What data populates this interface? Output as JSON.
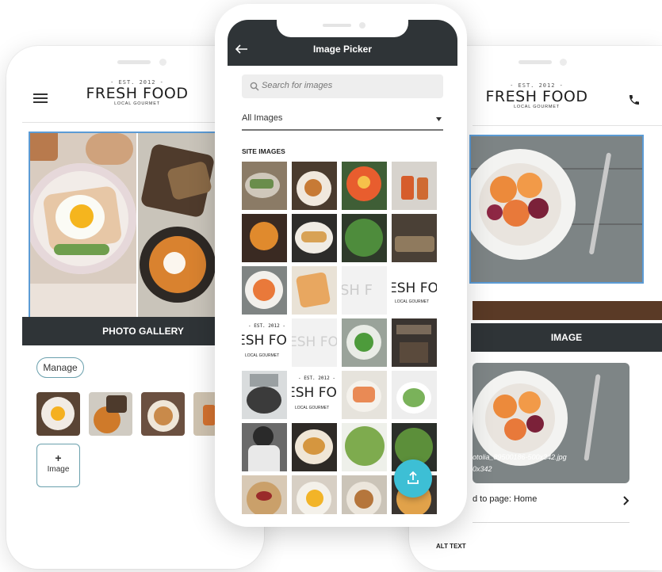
{
  "left_phone": {
    "brand": {
      "est": "- EST. 2012 -",
      "name": "FRESH FOOD",
      "sub": "LOCAL GOURMET"
    },
    "section_title": "PHOTO GALLERY",
    "manage_label": "Manage",
    "add_image_plus": "+",
    "add_image_label": "Image",
    "icons": {
      "menu": "hamburger-menu-icon"
    }
  },
  "center_phone": {
    "header": {
      "title": "Image Picker",
      "back_icon": "back-arrow-icon"
    },
    "search": {
      "placeholder": "Search for images",
      "icon": "search-icon"
    },
    "filter": {
      "selected": "All Images",
      "icon": "caret-down-icon"
    },
    "section_label": "SITE IMAGES",
    "tile_text": {
      "est": "- EST. 2012 -",
      "name_partial_a": "ESH FO",
      "name_partial_b": "ESH FO",
      "sub": "LOCAL GOURMET"
    },
    "fab_icon": "upload-icon"
  },
  "right_phone": {
    "brand": {
      "est": "- EST. 2012 -",
      "name": "FRESH FOOD",
      "sub": "LOCAL GOURMET"
    },
    "section_title": "IMAGE",
    "filename": "otolia_89500186-500x342.jpg",
    "dims": "0x342",
    "link_label": "d to page: Home",
    "alt_label": "ALT TEXT",
    "icons": {
      "phone": "phone-icon",
      "chevron": "chevron-right-icon"
    }
  }
}
